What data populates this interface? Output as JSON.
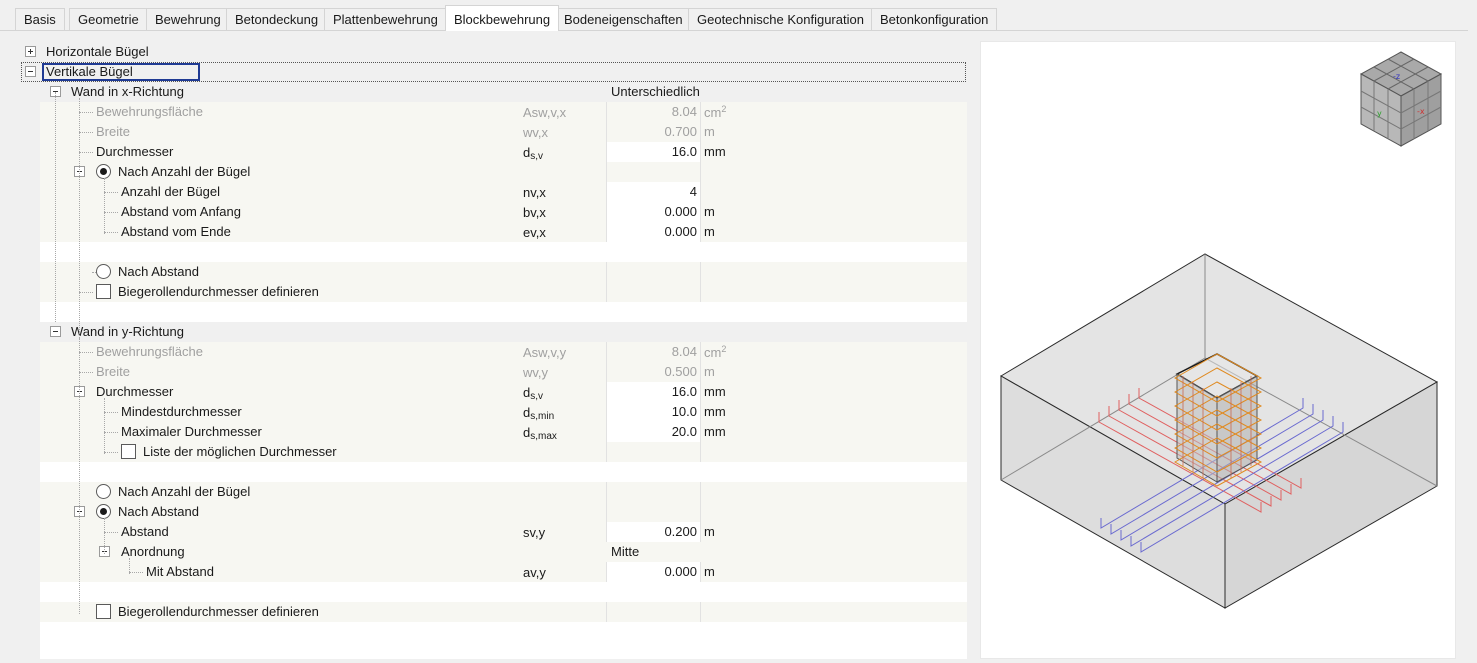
{
  "tabs": [
    "Basis",
    "Geometrie",
    "Bewehrung",
    "Betondeckung",
    "Plattenbewehrung",
    "Blockbewehrung",
    "Bodeneigenschaften",
    "Geotechnische Konfiguration",
    "Betonkonfiguration"
  ],
  "active_tab": "Blockbewehrung",
  "tree": {
    "horizontal": "Horizontale Bügel",
    "vertical": "Vertikale Bügel",
    "wall_x": {
      "label": "Wand in x-Richtung",
      "value": "Unterschiedlich",
      "area": {
        "label": "Bewehrungsfläche",
        "sym": "Asw,v,x",
        "value": "8.04",
        "unit": "cm",
        "unit_exp": "2"
      },
      "width": {
        "label": "Breite",
        "sym": "wv,x",
        "value": "0.700",
        "unit": "m"
      },
      "diameter": {
        "label": "Durchmesser",
        "sym_main": "d",
        "sym_sub": "s,v",
        "value": "16.0",
        "unit": "mm"
      },
      "by_count": {
        "label": "Nach Anzahl der Bügel",
        "selected": true
      },
      "count": {
        "label": "Anzahl der Bügel",
        "sym": "nv,x",
        "value": "4"
      },
      "start": {
        "label": "Abstand vom Anfang",
        "sym": "bv,x",
        "value": "0.000",
        "unit": "m"
      },
      "end": {
        "label": "Abstand vom Ende",
        "sym": "ev,x",
        "value": "0.000",
        "unit": "m"
      },
      "by_spacing": {
        "label": "Nach Abstand",
        "selected": false
      },
      "bend": {
        "label": "Biegerollendurchmesser definieren",
        "checked": false
      }
    },
    "wall_y": {
      "label": "Wand in y-Richtung",
      "area": {
        "label": "Bewehrungsfläche",
        "sym": "Asw,v,y",
        "value": "8.04",
        "unit": "cm",
        "unit_exp": "2"
      },
      "width": {
        "label": "Breite",
        "sym": "wv,y",
        "value": "0.500",
        "unit": "m"
      },
      "diameter": {
        "label": "Durchmesser",
        "sym_main": "d",
        "sym_sub": "s,v",
        "value": "16.0",
        "unit": "mm"
      },
      "min_d": {
        "label": "Mindestdurchmesser",
        "sym_main": "d",
        "sym_sub": "s,min",
        "value": "10.0",
        "unit": "mm"
      },
      "max_d": {
        "label": "Maximaler Durchmesser",
        "sym_main": "d",
        "sym_sub": "s,max",
        "value": "20.0",
        "unit": "mm"
      },
      "list": {
        "label": "Liste der möglichen Durchmesser",
        "checked": false
      },
      "by_count": {
        "label": "Nach Anzahl der Bügel",
        "selected": false
      },
      "by_spacing": {
        "label": "Nach Abstand",
        "selected": true
      },
      "spacing": {
        "label": "Abstand",
        "sym": "sv,y",
        "value": "0.200",
        "unit": "m"
      },
      "arrangement": {
        "label": "Anordnung",
        "value": "Mitte"
      },
      "with_spacing": {
        "label": "Mit Abstand",
        "sym": "av,y",
        "value": "0.000",
        "unit": "m"
      },
      "bend": {
        "label": "Biegerollendurchmesser definieren",
        "checked": false
      }
    }
  },
  "preview": {
    "navcube_axes": [
      "y",
      "-x",
      "-z"
    ],
    "colors": {
      "concrete_edge": "#2a2a2a",
      "bars_x": "#e06060",
      "bars_y": "#6a6ad0",
      "stirrups": "#e08a20"
    }
  }
}
